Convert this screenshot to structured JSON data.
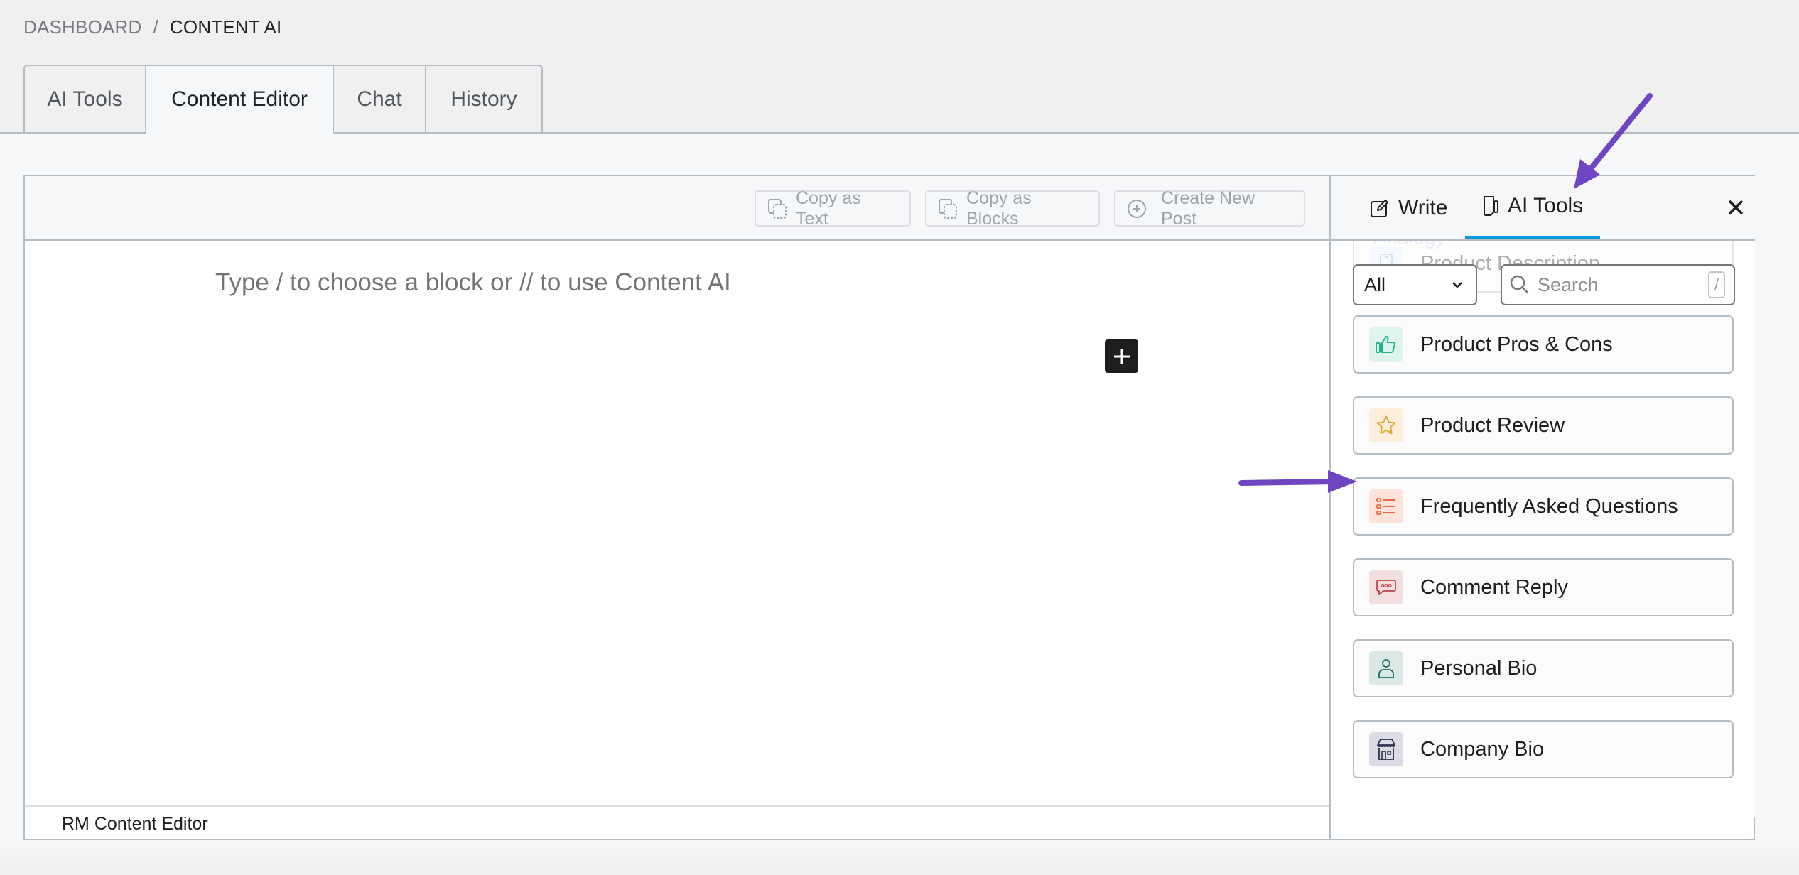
{
  "breadcrumb": {
    "parent": "DASHBOARD",
    "separator": "/",
    "current": "CONTENT AI"
  },
  "top_tabs": [
    {
      "label": "AI Tools",
      "active": false
    },
    {
      "label": "Content Editor",
      "active": true
    },
    {
      "label": "Chat",
      "active": false
    },
    {
      "label": "History",
      "active": false
    }
  ],
  "toolbar": {
    "copy_text_label": "Copy as Text",
    "copy_blocks_label": "Copy as Blocks",
    "create_post_label": "Create New Post"
  },
  "editor": {
    "placeholder": "Type / to choose a block or // to use Content AI",
    "add_block_icon": "plus-icon",
    "footer_label": "RM Content Editor"
  },
  "panel": {
    "tabs": [
      {
        "label": "Write",
        "icon": "edit-icon",
        "active": false
      },
      {
        "label": "AI Tools",
        "icon": "tools-icon",
        "active": true
      }
    ],
    "active_color": "#0e9ad6",
    "close_icon": "close-icon",
    "filter": {
      "selected": "All"
    },
    "search": {
      "placeholder": "Search",
      "value": "",
      "shortcut": "/"
    },
    "ghost_item": "Analogy",
    "tools": [
      {
        "label": "Product Description",
        "icon": "mobile-icon",
        "icon_color": "#7aa7e8",
        "icon_bg": "#e8f0fc",
        "faded": true
      },
      {
        "label": "Product Pros & Cons",
        "icon": "thumbs-up-icon",
        "icon_color": "#1fb389",
        "icon_bg": "#e0f4ee",
        "faded": false
      },
      {
        "label": "Product Review",
        "icon": "star-icon",
        "icon_color": "#e0a82e",
        "icon_bg": "#fbefdc",
        "faded": false
      },
      {
        "label": "Frequently Asked Questions",
        "icon": "list-icon",
        "icon_color": "#ef6a3f",
        "icon_bg": "#fde3da",
        "faded": false
      },
      {
        "label": "Comment Reply",
        "icon": "comment-icon",
        "icon_color": "#c0454a",
        "icon_bg": "#f3dfe0",
        "faded": false
      },
      {
        "label": "Personal Bio",
        "icon": "person-icon",
        "icon_color": "#1f6b63",
        "icon_bg": "#dae8e6",
        "faded": false
      },
      {
        "label": "Company Bio",
        "icon": "store-icon",
        "icon_color": "#2c2f4a",
        "icon_bg": "#dcdce6",
        "faded": false
      }
    ]
  },
  "annotations": {
    "arrow_color": "#6f46c1"
  }
}
